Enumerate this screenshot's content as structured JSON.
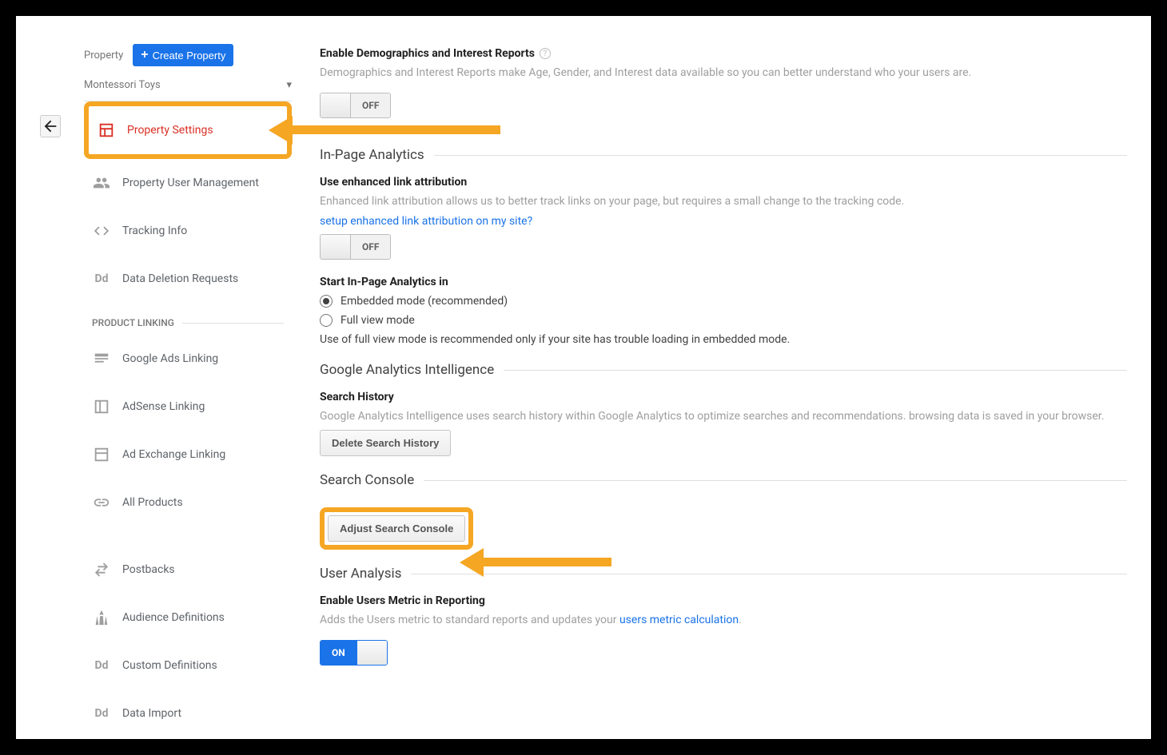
{
  "sidebar": {
    "property_label": "Property",
    "create_btn": "Create Property",
    "selected_property": "Montessori Toys",
    "items": {
      "settings": "Property Settings",
      "user_mgmt": "Property User Management",
      "tracking": "Tracking Info",
      "data_deletion": "Data Deletion Requests",
      "section_linking": "PRODUCT LINKING",
      "ads_linking": "Google Ads Linking",
      "adsense": "AdSense Linking",
      "adexchange": "Ad Exchange Linking",
      "all_products": "All Products",
      "postbacks": "Postbacks",
      "audience": "Audience Definitions",
      "custom": "Custom Definitions",
      "import": "Data Import"
    }
  },
  "content": {
    "demographics": {
      "title": "Enable Demographics and Interest Reports",
      "desc": "Demographics and Interest Reports make Age, Gender, and Interest data available so you can better understand who your users are.",
      "toggle": "OFF"
    },
    "inpage": {
      "section": "In-Page Analytics",
      "link_attr_title": "Use enhanced link attribution",
      "link_attr_desc": "Enhanced link attribution allows us to better track links on your page, but requires a small change to the tracking code.",
      "link_attr_link": "setup enhanced link attribution on my site?",
      "link_attr_toggle": "OFF",
      "start_title": "Start In-Page Analytics in",
      "opt_embedded": "Embedded mode (recommended)",
      "opt_full": "Full view mode",
      "full_note": "Use of full view mode is recommended only if your site has trouble loading in embedded mode."
    },
    "gai": {
      "section": "Google Analytics Intelligence",
      "search_title": "Search History",
      "search_desc": "Google Analytics Intelligence uses search history within Google Analytics to optimize searches and recommendations. browsing data is saved in your browser.",
      "delete_btn": "Delete Search History"
    },
    "sc": {
      "section": "Search Console",
      "adjust_btn": "Adjust Search Console"
    },
    "ua": {
      "section": "User Analysis",
      "title": "Enable Users Metric in Reporting",
      "desc_pre": "Adds the Users metric to standard reports and updates your ",
      "desc_link": "users metric calculation",
      "toggle": "ON"
    }
  }
}
